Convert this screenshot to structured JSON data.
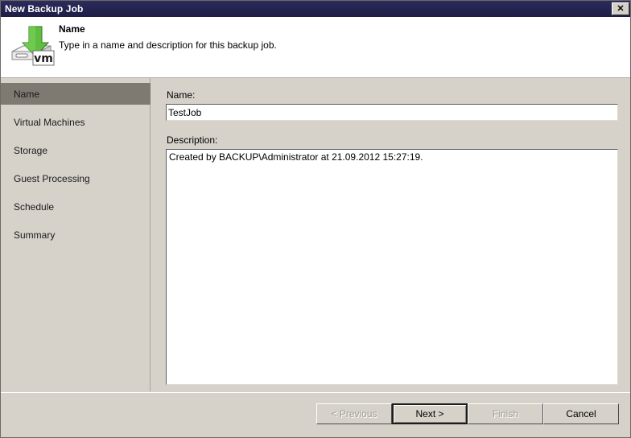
{
  "window": {
    "title": "New Backup Job",
    "close_label": "✕"
  },
  "header": {
    "icon": "backup-job-vm-icon",
    "title": "Name",
    "subtitle": "Type in a name and description for this backup job."
  },
  "sidebar": {
    "items": [
      {
        "label": "Name",
        "selected": true
      },
      {
        "label": "Virtual Machines",
        "selected": false
      },
      {
        "label": "Storage",
        "selected": false
      },
      {
        "label": "Guest Processing",
        "selected": false
      },
      {
        "label": "Schedule",
        "selected": false
      },
      {
        "label": "Summary",
        "selected": false
      }
    ]
  },
  "form": {
    "name_label": "Name:",
    "name_value": "TestJob",
    "name_placeholder": "",
    "description_label": "Description:",
    "description_value": "Created by BACKUP\\Administrator at 21.09.2012 15:27:19.",
    "description_placeholder": ""
  },
  "footer": {
    "buttons": [
      {
        "label": "< Previous",
        "state": "disabled"
      },
      {
        "label": "Next >",
        "state": "default"
      },
      {
        "label": "Finish",
        "state": "disabled"
      },
      {
        "label": "Cancel",
        "state": "normal"
      }
    ]
  },
  "colors": {
    "titlebar": "#23234e",
    "dialog_face": "#d6d2ca",
    "selection": "#7e7971",
    "header_bg": "#ffffff",
    "arrow_green": "#49a33a"
  }
}
